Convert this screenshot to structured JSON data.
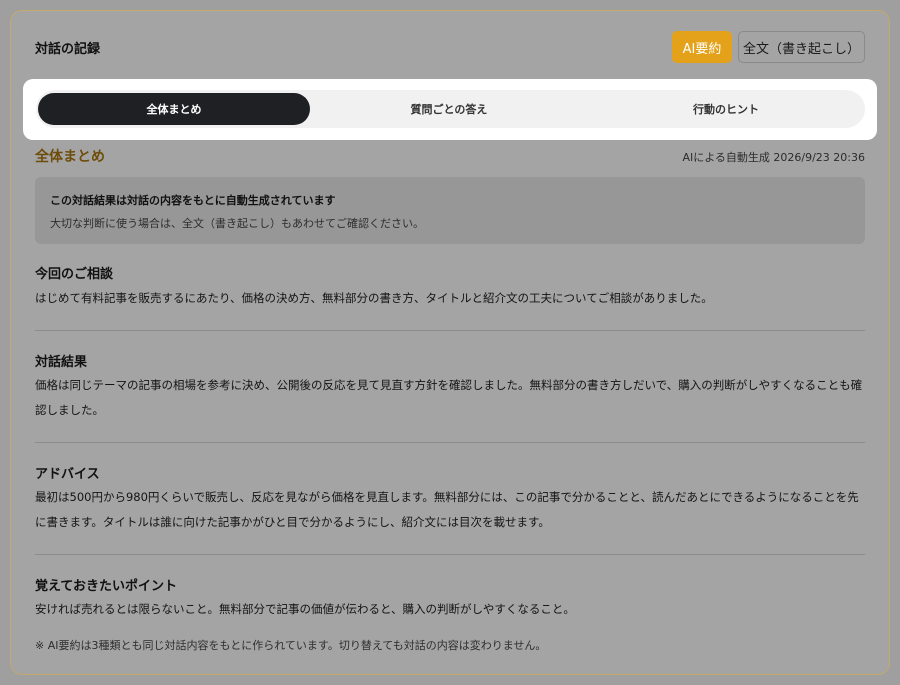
{
  "header": {
    "title": "対話の記録",
    "ai_summary_button": "AI要約",
    "full_text_button": "全文（書き起こし）"
  },
  "tabs": [
    {
      "label": "全体まとめ",
      "active": true
    },
    {
      "label": "質問ごとの答え",
      "active": false
    },
    {
      "label": "行動のヒント",
      "active": false
    }
  ],
  "section": {
    "title": "全体まとめ",
    "meta": "AIによる自動生成 2026/9/23 20:36"
  },
  "notice": {
    "title": "この対話結果は対話の内容をもとに自動生成されています",
    "body": "大切な判断に使う場合は、全文（書き起こし）もあわせてご確認ください。"
  },
  "blocks": [
    {
      "title": "今回のご相談",
      "text": "はじめて有料記事を販売するにあたり、価格の決め方、無料部分の書き方、タイトルと紹介文の工夫についてご相談がありました。"
    },
    {
      "title": "対話結果",
      "text": "価格は同じテーマの記事の相場を参考に決め、公開後の反応を見て見直す方針を確認しました。無料部分の書き方しだいで、購入の判断がしやすくなることも確認しました。"
    },
    {
      "title": "アドバイス",
      "text": "最初は500円から980円くらいで販売し、反応を見ながら価格を見直します。無料部分には、この記事で分かることと、読んだあとにできるようになることを先に書きます。タイトルは誰に向けた記事かがひと目で分かるようにし、紹介文には目次を載せます。"
    },
    {
      "title": "覚えておきたいポイント",
      "text": "安ければ売れるとは限らないこと。無料部分で記事の価値が伝わると、購入の判断がしやすくなること。"
    }
  ],
  "footnote": "※ AI要約は3種類とも同じ対話内容をもとに作られています。切り替えても対話の内容は変わりません。",
  "colors": {
    "accent": "#e4a21b",
    "active_tab": "#1f2024",
    "section_title": "#6e4d0a"
  }
}
